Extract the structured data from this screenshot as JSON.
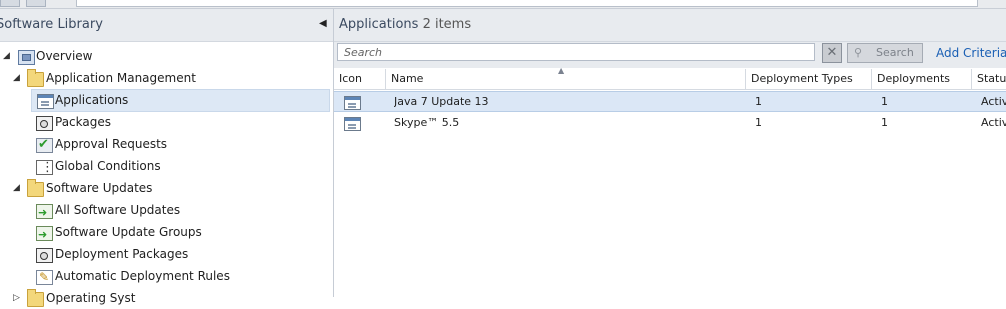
{
  "nav": {
    "title": "Software Library",
    "items": [
      {
        "label": "Overview",
        "icon": "overview-icon"
      },
      {
        "label": "Application Management",
        "icon": "folder-icon"
      },
      {
        "label": "Applications",
        "icon": "application-icon"
      },
      {
        "label": "Packages",
        "icon": "package-icon"
      },
      {
        "label": "Approval Requests",
        "icon": "approval-icon"
      },
      {
        "label": "Global Conditions",
        "icon": "global-conditions-icon"
      },
      {
        "label": "Software Updates",
        "icon": "folder-icon"
      },
      {
        "label": "All Software Updates",
        "icon": "software-updates-icon"
      },
      {
        "label": "Software Update Groups",
        "icon": "software-updates-icon"
      },
      {
        "label": "Deployment Packages",
        "icon": "package-icon"
      },
      {
        "label": "Automatic Deployment Rules",
        "icon": "deployment-rules-icon"
      },
      {
        "label": "Operating Syst",
        "icon": "folder-icon"
      }
    ]
  },
  "content": {
    "title": "Applications",
    "count": "2 items",
    "search_placeholder": "Search",
    "search_button": "Search",
    "add_criteria": "Add Criteria",
    "columns": [
      "Icon",
      "Name",
      "Deployment Types",
      "Deployments",
      "Status"
    ],
    "rows": [
      {
        "name": "Java 7 Update 13",
        "deployment_types": "1",
        "deployments": "1",
        "status": "Active"
      },
      {
        "name": "Skype™ 5.5",
        "deployment_types": "1",
        "deployments": "1",
        "status": "Active"
      }
    ]
  },
  "colors": {
    "header_bg": "#e8ebef",
    "selected_row": "#dbe7f6",
    "link": "#1a5fb4"
  }
}
